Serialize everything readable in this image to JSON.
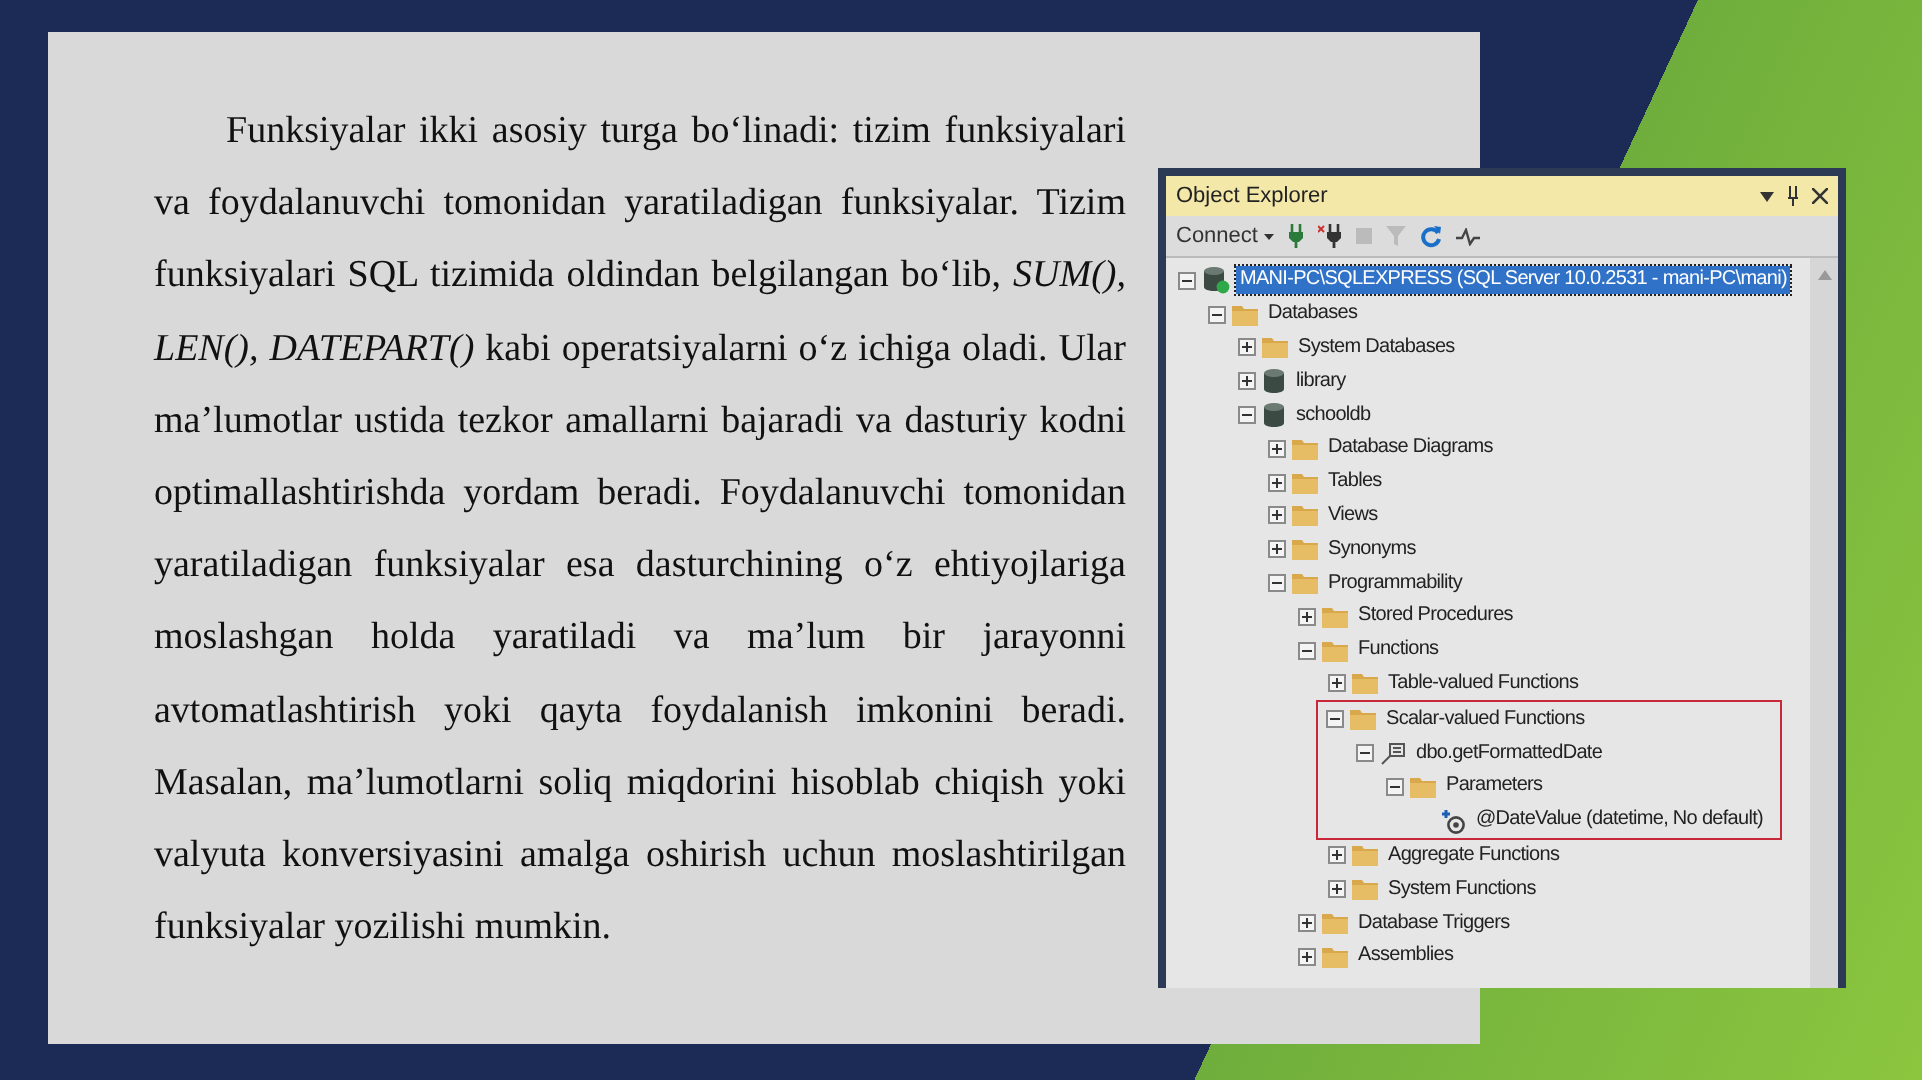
{
  "paragraph": "Funksiyalar ikki asosiy turga bo‘linadi: tizim funksiyalari va foydalanuvchi tomonidan yaratiladigan funksiyalar. Tizim funksiyalari SQL tizimida oldindan belgilangan bo‘lib, *SUM(), LEN(), DATEPART()* kabi operatsiyalarni o‘z ichiga oladi. Ular ma’lumotlar ustida tezkor amallarni bajaradi va dasturiy kodni optimallashtirishda yordam beradi. Foydalanuvchi tomonidan yaratiladigan funksiyalar esa dasturchining o‘z ehtiyojlariga moslashgan holda yaratiladi va ma’lum bir jarayonni avtomatlashtirish yoki qayta foydalanish imkonini beradi. Masalan, ma’lumotlarni soliq miqdorini hisoblab chiqish yoki valyuta konversiyasini amalga oshirish uchun moslashtirilgan funksiyalar yozilishi mumkin.",
  "object_explorer": {
    "title": "Object Explorer",
    "connect_label": "Connect",
    "tree": [
      {
        "label": "MANI-PC\\SQLEXPRESS (SQL Server 10.0.2531 - mani-PC\\mani)",
        "kind": "server",
        "expanded": true,
        "selected": true,
        "highlighted": false,
        "children": [
          {
            "label": "Databases",
            "kind": "folder",
            "expanded": true,
            "selected": false,
            "highlighted": false,
            "children": [
              {
                "label": "System Databases",
                "kind": "folder",
                "expanded": false,
                "selected": false,
                "highlighted": false
              },
              {
                "label": "library",
                "kind": "database",
                "expanded": false,
                "selected": false,
                "highlighted": false
              },
              {
                "label": "schooldb",
                "kind": "database",
                "expanded": true,
                "selected": false,
                "highlighted": false,
                "children": [
                  {
                    "label": "Database Diagrams",
                    "kind": "folder",
                    "expanded": false,
                    "selected": false,
                    "highlighted": false
                  },
                  {
                    "label": "Tables",
                    "kind": "folder",
                    "expanded": false,
                    "selected": false,
                    "highlighted": false
                  },
                  {
                    "label": "Views",
                    "kind": "folder",
                    "expanded": false,
                    "selected": false,
                    "highlighted": false
                  },
                  {
                    "label": "Synonyms",
                    "kind": "folder",
                    "expanded": false,
                    "selected": false,
                    "highlighted": false
                  },
                  {
                    "label": "Programmability",
                    "kind": "folder",
                    "expanded": true,
                    "selected": false,
                    "highlighted": false,
                    "children": [
                      {
                        "label": "Stored Procedures",
                        "kind": "folder",
                        "expanded": false,
                        "selected": false,
                        "highlighted": false
                      },
                      {
                        "label": "Functions",
                        "kind": "folder",
                        "expanded": true,
                        "selected": false,
                        "highlighted": false,
                        "children": [
                          {
                            "label": "Table-valued Functions",
                            "kind": "folder",
                            "expanded": false,
                            "selected": false,
                            "highlighted": false
                          },
                          {
                            "label": "Scalar-valued Functions",
                            "kind": "folder",
                            "expanded": true,
                            "selected": false,
                            "highlighted": true,
                            "children": [
                              {
                                "label": "dbo.getFormattedDate",
                                "kind": "function",
                                "expanded": true,
                                "selected": false,
                                "highlighted": false,
                                "children": [
                                  {
                                    "label": "Parameters",
                                    "kind": "folder",
                                    "expanded": true,
                                    "selected": false,
                                    "highlighted": false,
                                    "children": [
                                      {
                                        "label": "@DateValue (datetime, No default)",
                                        "kind": "parameter",
                                        "selected": false,
                                        "highlighted": false
                                      }
                                    ]
                                  }
                                ]
                              }
                            ]
                          },
                          {
                            "label": "Aggregate Functions",
                            "kind": "folder",
                            "expanded": false,
                            "selected": false,
                            "highlighted": false
                          },
                          {
                            "label": "System Functions",
                            "kind": "folder",
                            "expanded": false,
                            "selected": false,
                            "highlighted": false
                          }
                        ]
                      },
                      {
                        "label": "Database Triggers",
                        "kind": "folder",
                        "expanded": false,
                        "selected": false,
                        "highlighted": false
                      },
                      {
                        "label": "Assemblies",
                        "kind": "folder",
                        "expanded": false,
                        "selected": false,
                        "highlighted": false
                      }
                    ]
                  }
                ]
              }
            ]
          }
        ]
      }
    ]
  }
}
